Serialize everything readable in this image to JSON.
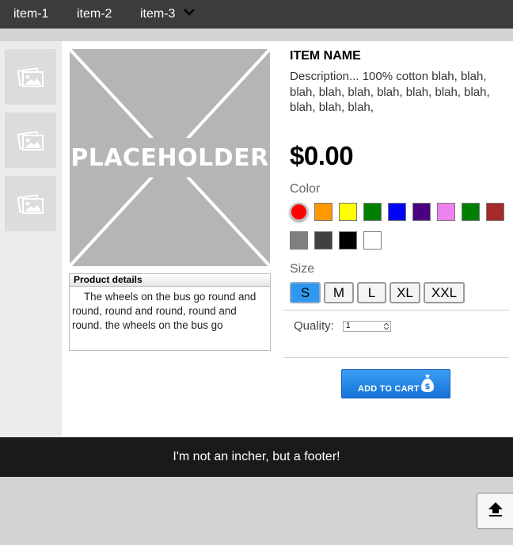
{
  "nav": {
    "items": [
      {
        "label": "item-1"
      },
      {
        "label": "item-2"
      },
      {
        "label": "item-3",
        "has_dropdown": true,
        "icon": "chevron-down-icon"
      }
    ]
  },
  "gallery": {
    "thumbnails": [
      {
        "icon": "image-icon"
      },
      {
        "icon": "image-icon"
      },
      {
        "icon": "image-icon"
      }
    ],
    "main_image_text": "PLACEHOLDER"
  },
  "details": {
    "heading": "Product details",
    "body": "The wheels on the bus go round and round, round and round, round and round. the wheels on the bus go"
  },
  "product": {
    "name": "ITEM NAME",
    "description": "Description... 100% cotton blah, blah, blah, blah, blah, blah, blah, blah, blah, blah, blah, blah,",
    "price": "$0.00",
    "color_label": "Color",
    "colors": [
      "#ff0000",
      "#ff9900",
      "#ffff00",
      "#008000",
      "#0000ff",
      "#4b0082",
      "#ee82ee",
      "#008000",
      "#a52a2a",
      "#808080",
      "#404040",
      "#000000",
      "#ffffff"
    ],
    "selected_color": "#ff0000",
    "size_label": "Size",
    "sizes": [
      "S",
      "M",
      "L",
      "XL",
      "XXL"
    ],
    "selected_size": "S",
    "quantity_label": "Quality:",
    "quantity_value": "1",
    "add_to_cart_label": "ADD TO CART",
    "cart_icon": "money-bag-icon"
  },
  "footer": {
    "text": "I'm not an incher, but a footer!"
  },
  "back_to_top": {
    "icon": "arrow-up-to-top-icon"
  },
  "colors": {
    "nav_bg": "#3c3c3c",
    "footer_bg": "#1a1a1a",
    "accent": "#2e97ef",
    "page_bg": "#d3d3d3"
  }
}
